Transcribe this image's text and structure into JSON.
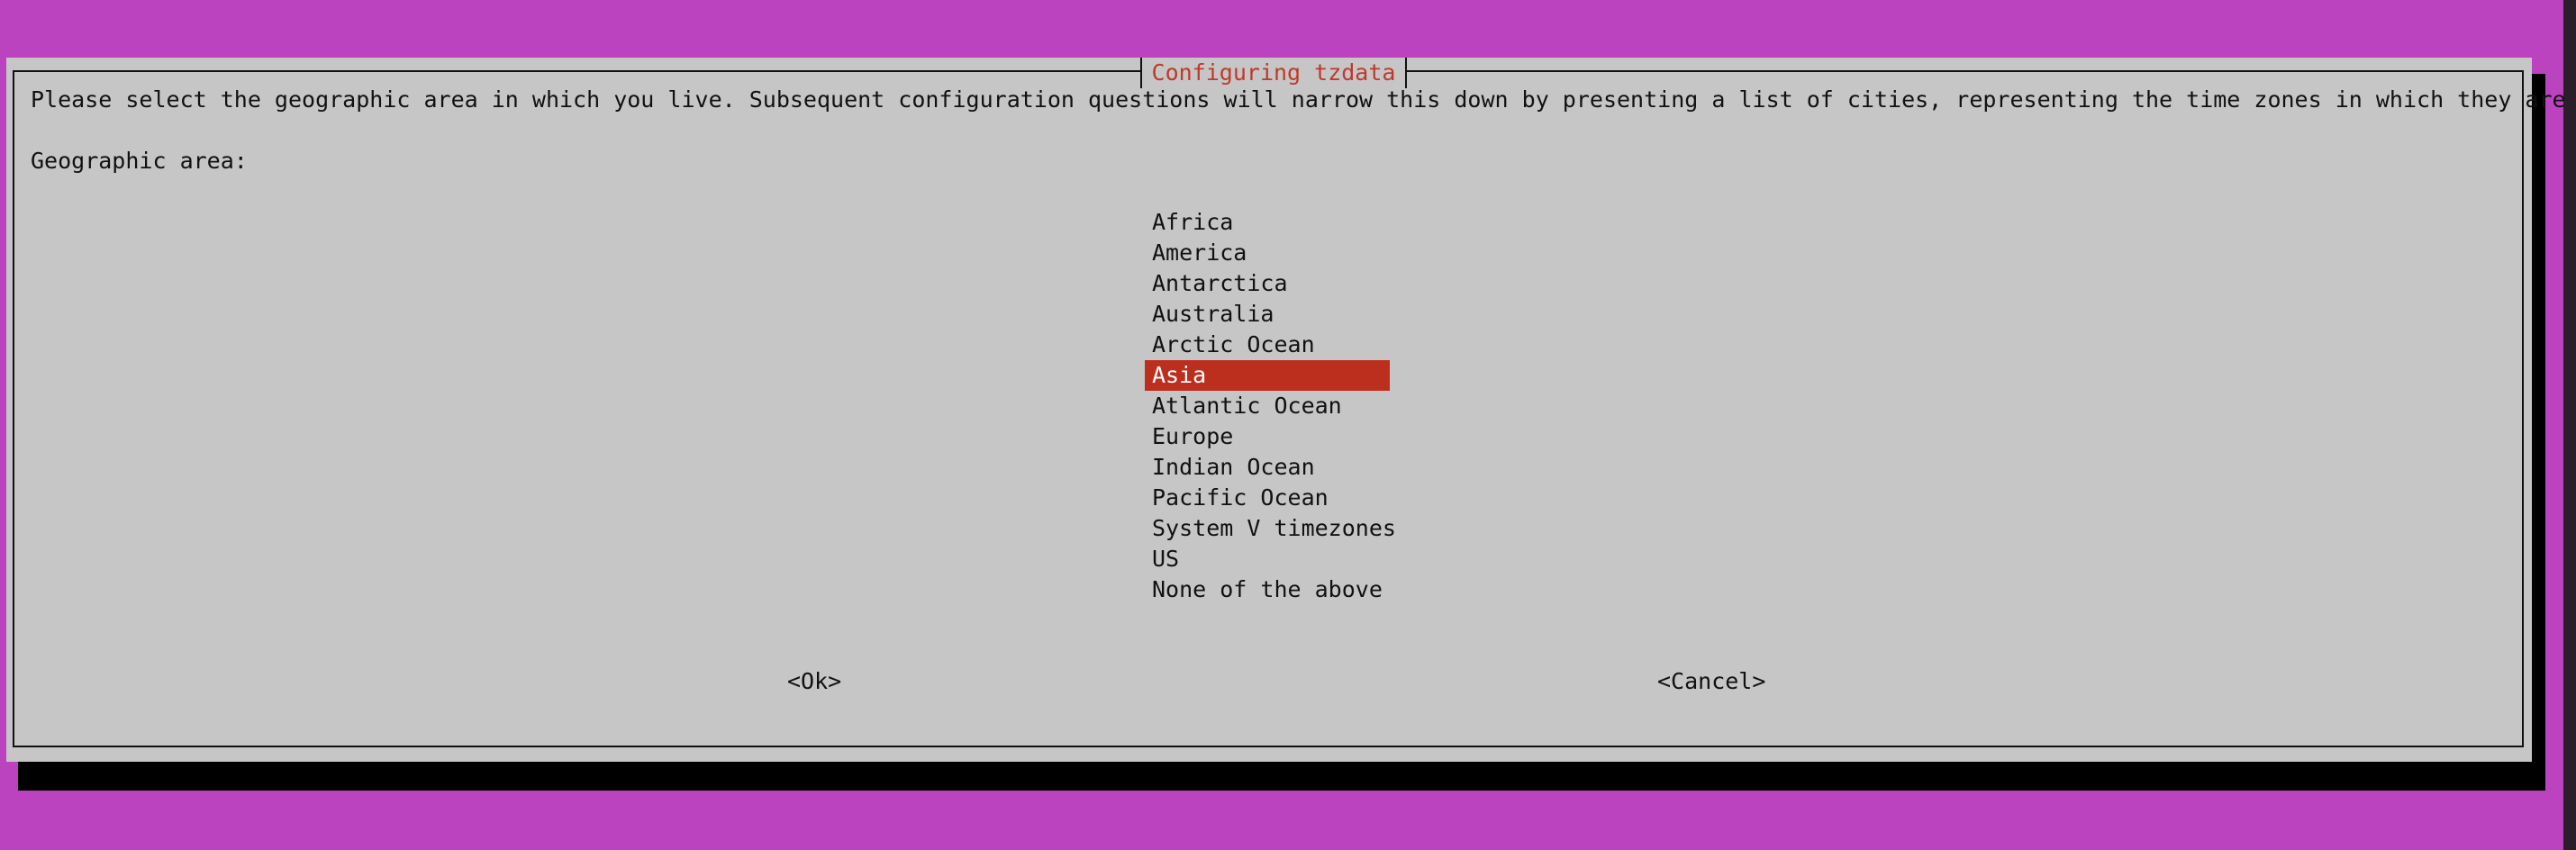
{
  "dialog": {
    "title": "Configuring tzdata",
    "prompt": "Please select the geographic area in which you live. Subsequent configuration questions will narrow this down by presenting a list of cities, representing the time zones in which they are located.",
    "list_label": "Geographic area:",
    "items": [
      "Africa",
      "America",
      "Antarctica",
      "Australia",
      "Arctic Ocean",
      "Asia",
      "Atlantic Ocean",
      "Europe",
      "Indian Ocean",
      "Pacific Ocean",
      "System V timezones",
      "US",
      "None of the above"
    ],
    "selected_item": "Asia",
    "buttons": {
      "ok": "<Ok>",
      "cancel": "<Cancel>"
    }
  },
  "colors": {
    "background": "#bb43bf",
    "dialog": "#c6c6c6",
    "selection": "#bc2e1e",
    "title_text": "#c0392b"
  }
}
